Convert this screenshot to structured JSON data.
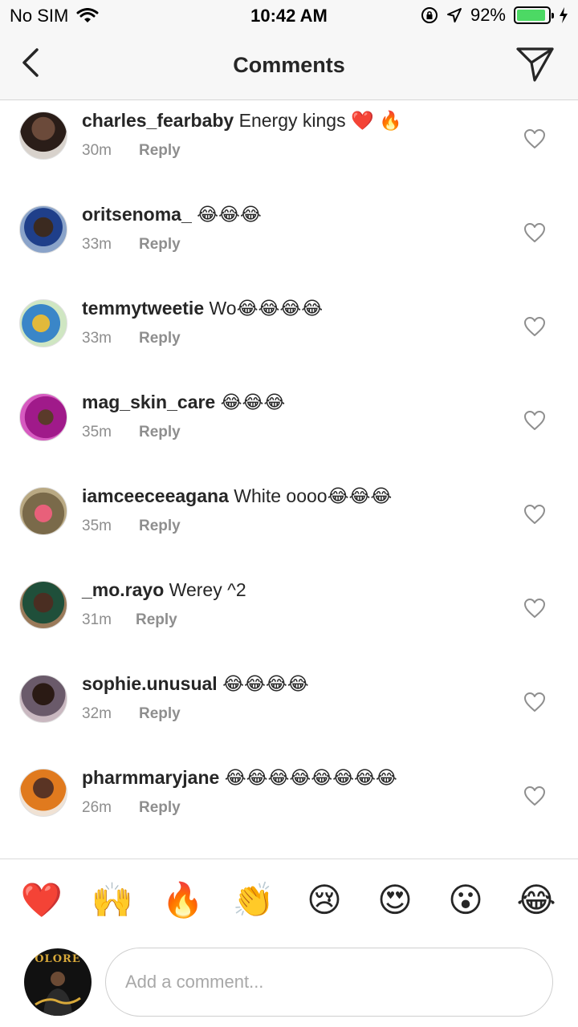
{
  "status_bar": {
    "carrier": "No SIM",
    "time": "10:42 AM",
    "battery_percent": "92%",
    "battery_level": 0.92
  },
  "nav": {
    "title": "Comments",
    "back_icon": "chevron-left-icon",
    "send_icon": "paper-plane-icon"
  },
  "comments": [
    {
      "username": "charles_fearbaby",
      "text": "Energy kings ❤️ 🔥",
      "time": "30m",
      "reply": "Reply"
    },
    {
      "username": "oritsenoma_",
      "text": "😂😂😂",
      "time": "33m",
      "reply": "Reply"
    },
    {
      "username": "temmytweetie",
      "text": "Wo😂😂😂😂",
      "time": "33m",
      "reply": "Reply"
    },
    {
      "username": "mag_skin_care",
      "text": "😂😂😂",
      "time": "35m",
      "reply": "Reply"
    },
    {
      "username": "iamceeceeagana",
      "text": "White oooo😂😂😂",
      "time": "35m",
      "reply": "Reply"
    },
    {
      "username": "_mo.rayo",
      "text": "Werey ^2",
      "time": "31m",
      "reply": "Reply"
    },
    {
      "username": "sophie.unusual",
      "text": "😂😂😂😂",
      "time": "32m",
      "reply": "Reply"
    },
    {
      "username": "pharmmaryjane",
      "text": "😂😂😂😂😂😂😂😂",
      "time": "26m",
      "reply": "Reply"
    }
  ],
  "quick_emojis": [
    "❤️",
    "🙌",
    "🔥",
    "👏",
    "😢",
    "😍",
    "😮",
    "😂"
  ],
  "composer": {
    "placeholder": "Add a comment...",
    "avatar_text": "OLORE"
  },
  "colors": {
    "text": "#262626",
    "meta": "#8e8e8e",
    "battery": "#4cd964",
    "bar_bg": "#f7f7f7"
  }
}
